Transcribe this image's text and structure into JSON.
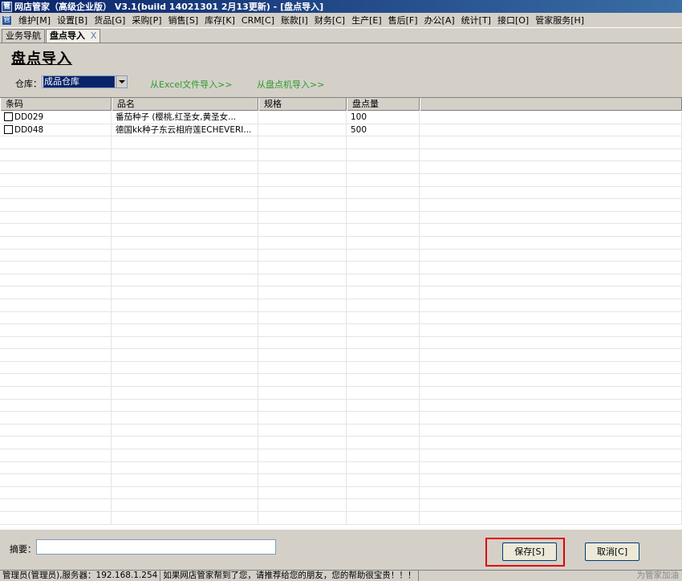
{
  "window": {
    "title": "网店管家（高级企业版） V3.1(build 14021301 2月13更新) - [盘点导入]",
    "icon_glyph": "管"
  },
  "menubar": {
    "items": [
      "维护[M]",
      "设置[B]",
      "货品[G]",
      "采购[P]",
      "销售[S]",
      "库存[K]",
      "CRM[C]",
      "账款[I]",
      "财务[C]",
      "生产[E]",
      "售后[F]",
      "办公[A]",
      "统计[T]",
      "接口[O]",
      "管家服务[H]"
    ]
  },
  "tabs": [
    {
      "label": "业务导航",
      "active": false
    },
    {
      "label": "盘点导入",
      "active": true,
      "close": "X"
    }
  ],
  "page": {
    "title": "盘点导入",
    "warehouse_label": "仓库：",
    "warehouse_value": "成品仓库",
    "link_excel": "从Excel文件导入>>",
    "link_counter": "从盘点机导入>>"
  },
  "table": {
    "columns": [
      "条码",
      "品名",
      "规格",
      "盘点量",
      ""
    ],
    "rows": [
      {
        "barcode": "DD029",
        "name": "番茄种子 (樱桃,红圣女,黄圣女...",
        "spec": "",
        "qty": "100"
      },
      {
        "barcode": "DD048",
        "name": "德国kk种子东云相府莲ECHEVERI...",
        "spec": "",
        "qty": "500"
      }
    ]
  },
  "footer": {
    "summary_label": "摘要：",
    "summary_value": "",
    "save_label": "保存[S]",
    "cancel_label": "取消[C]"
  },
  "status": {
    "user": "管理员(管理员),服务器：192.168.1.254",
    "message": "如果网店管家帮到了您，请推荐给您的朋友，您的帮助很宝贵！！！",
    "right": "为管家加油"
  },
  "colors": {
    "titlebar": "#0a246a",
    "link": "#2d9a2d",
    "highlight": "#e00000"
  }
}
